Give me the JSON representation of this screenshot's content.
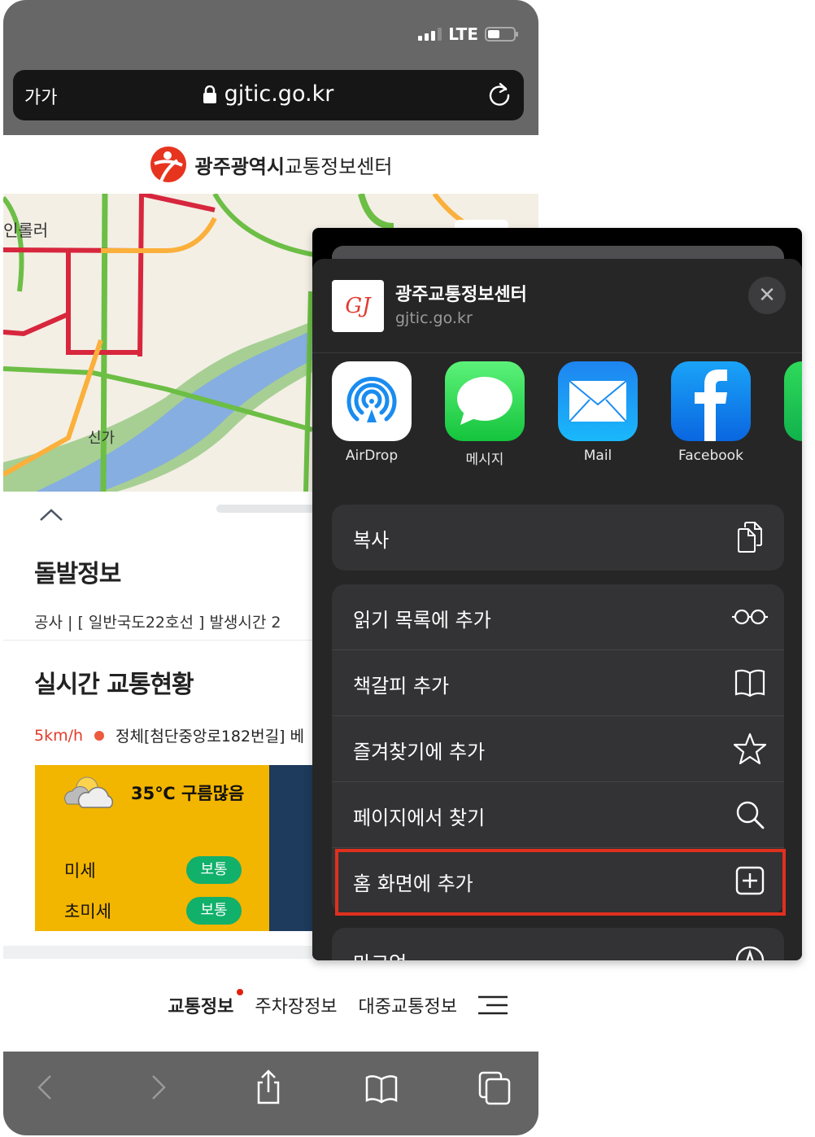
{
  "status_bar": {
    "network": "LTE",
    "signal_bars": 3,
    "signal_max": 4
  },
  "browser": {
    "text_size_label": "가가",
    "url": "gjtic.go.kr",
    "icons": {
      "lock": "lock-icon",
      "reload": "reload-icon"
    }
  },
  "site": {
    "logo_bold": "광주광역시",
    "logo_rest": "교통정보센터"
  },
  "map": {
    "labels": [
      "라인롤러",
      "신가"
    ]
  },
  "panel": {
    "incident_title": "돌발정보",
    "incident_line": "공사 | [ 일반국도22호선 ] 발생시간 2",
    "traffic_title": "실시간 교통현황",
    "traffic_speed": "5km/h",
    "traffic_status": "정체[첨단중앙로182번길] 베",
    "weather": {
      "temp_desc": "35℃ 구름많음",
      "fine_dust_label": "미세",
      "fine_dust_value": "보통",
      "ultra_fine_dust_label": "초미세",
      "ultra_fine_dust_value": "보통"
    }
  },
  "bottom_nav": {
    "items": [
      "교통정보",
      "주차장정보",
      "대중교통정보"
    ],
    "active": "교통정보"
  },
  "share_sheet": {
    "title": "광주교통정보센터",
    "url": "gjtic.go.kr",
    "favicon_text": "GJ",
    "apps": [
      {
        "label": "AirDrop",
        "icon": "airdrop-icon"
      },
      {
        "label": "메시지",
        "icon": "messages-icon"
      },
      {
        "label": "Mail",
        "icon": "mail-icon"
      },
      {
        "label": "Facebook",
        "icon": "facebook-icon"
      }
    ],
    "actions_group1": [
      {
        "label": "복사",
        "icon": "copy-icon"
      }
    ],
    "actions_group2": [
      {
        "label": "읽기 목록에 추가",
        "icon": "glasses-icon"
      },
      {
        "label": "책갈피 추가",
        "icon": "book-icon"
      },
      {
        "label": "즐겨찾기에 추가",
        "icon": "star-icon"
      },
      {
        "label": "페이지에서 찾기",
        "icon": "search-icon"
      },
      {
        "label": "홈 화면에 추가",
        "icon": "add-square-icon"
      }
    ],
    "actions_group3": [
      {
        "label": "마크업",
        "icon": "markup-icon"
      }
    ],
    "highlighted_action": "홈 화면에 추가"
  },
  "colors": {
    "highlight": "#e0301e",
    "speed_red": "#e23b2a",
    "weather_bg": "#f2b500",
    "pill_green": "#11b06b"
  }
}
